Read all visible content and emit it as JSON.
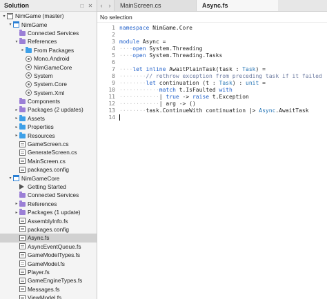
{
  "solution": {
    "header": "Solution",
    "items": [
      {
        "label": "NimGame (master)",
        "icon": "solution-icon",
        "arrow": "▾",
        "indent": 0
      },
      {
        "label": "NimGame",
        "icon": "project-icon",
        "arrow": "▾",
        "indent": 1
      },
      {
        "label": "Connected Services",
        "icon": "folder-purple-icon",
        "arrow": "",
        "indent": 2
      },
      {
        "label": "References",
        "icon": "folder-purple-icon",
        "arrow": "▾",
        "indent": 2
      },
      {
        "label": "From Packages",
        "icon": "folder-icon",
        "arrow": "▸",
        "indent": 3
      },
      {
        "label": "Mono.Android",
        "icon": "reference-icon",
        "arrow": "",
        "indent": 3
      },
      {
        "label": "NimGameCore",
        "icon": "reference-icon",
        "arrow": "",
        "indent": 3
      },
      {
        "label": "System",
        "icon": "reference-icon",
        "arrow": "",
        "indent": 3
      },
      {
        "label": "System.Core",
        "icon": "reference-icon",
        "arrow": "",
        "indent": 3
      },
      {
        "label": "System.Xml",
        "icon": "reference-icon",
        "arrow": "",
        "indent": 3
      },
      {
        "label": "Components",
        "icon": "folder-purple-icon",
        "arrow": "",
        "indent": 2
      },
      {
        "label": "Packages (2 updates)",
        "icon": "folder-purple-icon",
        "arrow": "▸",
        "indent": 2
      },
      {
        "label": "Assets",
        "icon": "folder-icon",
        "arrow": "▸",
        "indent": 2
      },
      {
        "label": "Properties",
        "icon": "folder-icon",
        "arrow": "▸",
        "indent": 2
      },
      {
        "label": "Resources",
        "icon": "folder-icon",
        "arrow": "▸",
        "indent": 2
      },
      {
        "label": "GameScreen.cs",
        "icon": "file-icon",
        "arrow": "",
        "indent": 2
      },
      {
        "label": "GenerateScreen.cs",
        "icon": "file-icon",
        "arrow": "",
        "indent": 2
      },
      {
        "label": "MainScreen.cs",
        "icon": "file-icon",
        "arrow": "",
        "indent": 2
      },
      {
        "label": "packages.config",
        "icon": "file-icon",
        "arrow": "",
        "indent": 2
      },
      {
        "label": "NimGameCore",
        "icon": "project-icon",
        "arrow": "▾",
        "indent": 1
      },
      {
        "label": "Getting Started",
        "icon": "play-icon",
        "arrow": "",
        "indent": 2
      },
      {
        "label": "Connected Services",
        "icon": "folder-purple-icon",
        "arrow": "",
        "indent": 2
      },
      {
        "label": "References",
        "icon": "folder-purple-icon",
        "arrow": "▸",
        "indent": 2
      },
      {
        "label": "Packages (1 update)",
        "icon": "folder-purple-icon",
        "arrow": "▸",
        "indent": 2
      },
      {
        "label": "AssemblyInfo.fs",
        "icon": "file-icon",
        "arrow": "",
        "indent": 2
      },
      {
        "label": "packages.config",
        "icon": "file-icon",
        "arrow": "",
        "indent": 2
      },
      {
        "label": "Async.fs",
        "icon": "file-icon",
        "arrow": "",
        "indent": 2,
        "selected": true
      },
      {
        "label": "AsyncEventQueue.fs",
        "icon": "file-icon",
        "arrow": "",
        "indent": 2
      },
      {
        "label": "GameModelTypes.fs",
        "icon": "file-icon",
        "arrow": "",
        "indent": 2
      },
      {
        "label": "GameModel.fs",
        "icon": "file-icon",
        "arrow": "",
        "indent": 2
      },
      {
        "label": "Player.fs",
        "icon": "file-icon",
        "arrow": "",
        "indent": 2
      },
      {
        "label": "GameEngineTypes.fs",
        "icon": "file-icon",
        "arrow": "",
        "indent": 2
      },
      {
        "label": "Messages.fs",
        "icon": "file-icon",
        "arrow": "",
        "indent": 2
      },
      {
        "label": "ViewModel.fs",
        "icon": "file-icon",
        "arrow": "",
        "indent": 2
      }
    ]
  },
  "editor": {
    "tabs": [
      {
        "label": "MainScreen.cs",
        "active": false
      },
      {
        "label": "Async.fs",
        "active": true
      }
    ],
    "path": "No selection",
    "lines": [
      {
        "n": "1",
        "parts": [
          [
            "kw",
            "namespace"
          ],
          [
            "tx",
            " NimGame.Core"
          ]
        ]
      },
      {
        "n": "2",
        "parts": []
      },
      {
        "n": "3",
        "parts": [
          [
            "kw",
            "module"
          ],
          [
            "tx",
            " Async ="
          ]
        ]
      },
      {
        "n": "4",
        "parts": [
          [
            "dots",
            "····"
          ],
          [
            "kw",
            "open"
          ],
          [
            "tx",
            " System.Threading"
          ]
        ]
      },
      {
        "n": "5",
        "parts": [
          [
            "dots",
            "····"
          ],
          [
            "kw",
            "open"
          ],
          [
            "tx",
            " System.Threading.Tasks"
          ]
        ]
      },
      {
        "n": "6",
        "parts": []
      },
      {
        "n": "7",
        "parts": [
          [
            "dots",
            "····"
          ],
          [
            "kw",
            "let inline"
          ],
          [
            "tx",
            " AwaitPlainTask(task : "
          ],
          [
            "ty",
            "Task"
          ],
          [
            "tx",
            ") ="
          ]
        ]
      },
      {
        "n": "8",
        "parts": [
          [
            "dots",
            "········"
          ],
          [
            "cm",
            "// rethrow exception from preceding task if it failed"
          ]
        ]
      },
      {
        "n": "9",
        "parts": [
          [
            "dots",
            "········"
          ],
          [
            "kw",
            "let"
          ],
          [
            "tx",
            " continuation (t : "
          ],
          [
            "ty",
            "Task"
          ],
          [
            "tx",
            ") : "
          ],
          [
            "ty",
            "unit"
          ],
          [
            "tx",
            " ="
          ]
        ]
      },
      {
        "n": "10",
        "parts": [
          [
            "dots",
            "············"
          ],
          [
            "kw",
            "match"
          ],
          [
            "tx",
            " t.IsFaulted "
          ],
          [
            "kw",
            "with"
          ]
        ]
      },
      {
        "n": "11",
        "parts": [
          [
            "dots",
            "············"
          ],
          [
            "tx",
            "| "
          ],
          [
            "kw",
            "true"
          ],
          [
            "tx",
            " -> "
          ],
          [
            "kw",
            "raise"
          ],
          [
            "tx",
            " t.Exception"
          ]
        ]
      },
      {
        "n": "12",
        "parts": [
          [
            "dots",
            "············"
          ],
          [
            "tx",
            "| arg -> ()"
          ]
        ]
      },
      {
        "n": "13",
        "parts": [
          [
            "dots",
            "········"
          ],
          [
            "tx",
            "task.ContinueWith continuation |> "
          ],
          [
            "ty",
            "Async"
          ],
          [
            "tx",
            ".AwaitTask"
          ]
        ]
      },
      {
        "n": "14",
        "parts": []
      }
    ]
  }
}
